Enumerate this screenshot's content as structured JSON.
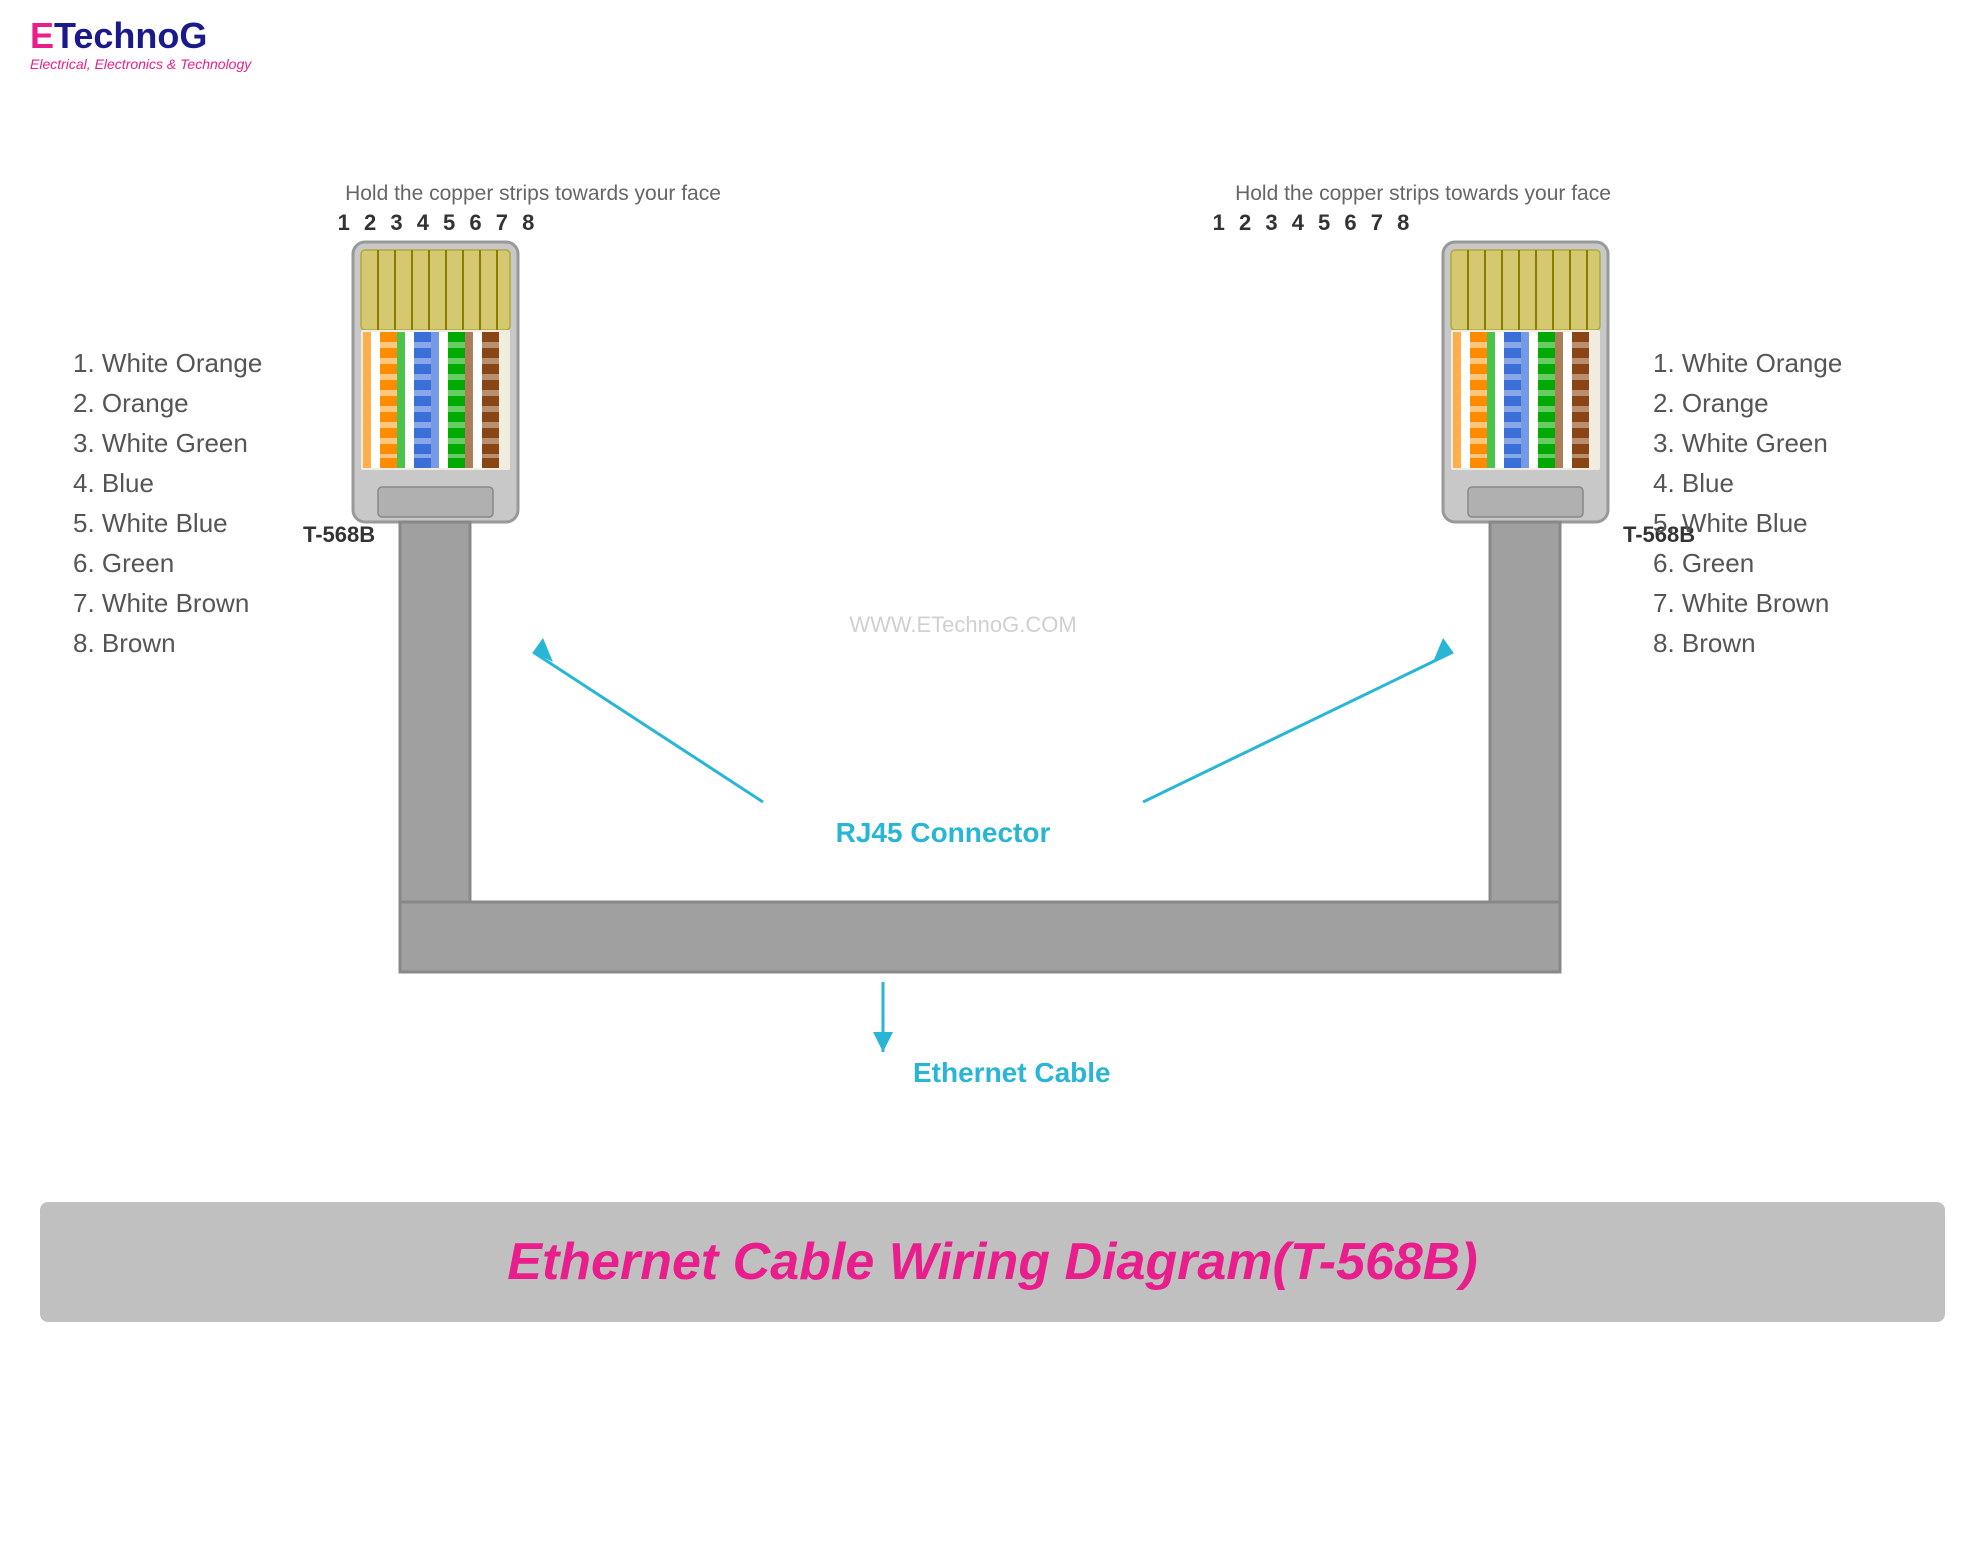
{
  "logo": {
    "e": "E",
    "technog": "TechnoG",
    "subtitle": "Electrical, Electronics & Technology"
  },
  "diagram": {
    "title": "Ethernet Cable Wiring Diagram(T-568B)",
    "instruction_left": "Hold the copper strips towards your face",
    "instruction_right": "Hold the copper strips towards your face",
    "pin_numbers": "1 2 3 4 5 6 7 8",
    "watermark": "WWW.ETechnoG.COM",
    "connector_label": "T-568B",
    "rj45_label": "RJ45 Connector",
    "cable_label": "Ethernet Cable",
    "wires_left": [
      {
        "num": "1.",
        "name": "White Orange",
        "color1": "#ffffff",
        "color2": "#ff8c00"
      },
      {
        "num": "2.",
        "name": "Orange",
        "color1": "#ff8c00",
        "color2": "#ff8c00"
      },
      {
        "num": "3.",
        "name": "White Green",
        "color1": "#ffffff",
        "color2": "#00aa00"
      },
      {
        "num": "4.",
        "name": "Blue",
        "color1": "#3a6fd8",
        "color2": "#3a6fd8"
      },
      {
        "num": "5.",
        "name": "White Blue",
        "color1": "#ffffff",
        "color2": "#3a6fd8"
      },
      {
        "num": "6.",
        "name": "Green",
        "color1": "#00aa00",
        "color2": "#00aa00"
      },
      {
        "num": "7.",
        "name": "White Brown",
        "color1": "#ffffff",
        "color2": "#8b4513"
      },
      {
        "num": "8.",
        "name": "Brown",
        "color1": "#8b4513",
        "color2": "#8b4513"
      }
    ],
    "wires_right": [
      {
        "num": "1.",
        "name": "White Orange",
        "color1": "#ffffff",
        "color2": "#ff8c00"
      },
      {
        "num": "2.",
        "name": "Orange",
        "color1": "#ff8c00",
        "color2": "#ff8c00"
      },
      {
        "num": "3.",
        "name": "White Green",
        "color1": "#ffffff",
        "color2": "#00aa00"
      },
      {
        "num": "4.",
        "name": "Blue",
        "color1": "#3a6fd8",
        "color2": "#3a6fd8"
      },
      {
        "num": "5.",
        "name": "White Blue",
        "color1": "#ffffff",
        "color2": "#3a6fd8"
      },
      {
        "num": "6.",
        "name": "Green",
        "color1": "#00aa00",
        "color2": "#00aa00"
      },
      {
        "num": "7.",
        "name": "White Brown",
        "color1": "#ffffff",
        "color2": "#8b4513"
      },
      {
        "num": "8.",
        "name": "Brown",
        "color1": "#8b4513",
        "color2": "#8b4513"
      }
    ]
  }
}
